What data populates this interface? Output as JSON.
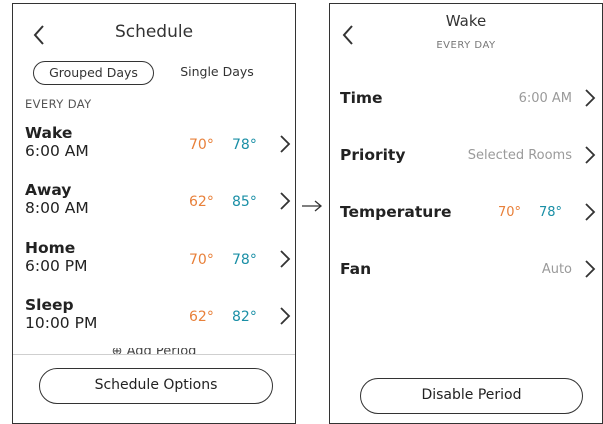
{
  "left": {
    "title": "Schedule",
    "segments": {
      "grouped": "Grouped Days",
      "single": "Single Days"
    },
    "section_label": "EVERY DAY",
    "periods": [
      {
        "name": "Wake",
        "time": "6:00 AM",
        "heat": "70°",
        "cool": "78°"
      },
      {
        "name": "Away",
        "time": "8:00 AM",
        "heat": "62°",
        "cool": "85°"
      },
      {
        "name": "Home",
        "time": "6:00 PM",
        "heat": "70°",
        "cool": "78°"
      },
      {
        "name": "Sleep",
        "time": "10:00 PM",
        "heat": "62°",
        "cool": "82°"
      }
    ],
    "add_period": "⊕ Add Period",
    "options_button": "Schedule Options"
  },
  "right": {
    "title": "Wake",
    "subtitle": "EVERY DAY",
    "rows": {
      "time": {
        "label": "Time",
        "value": "6:00 AM"
      },
      "priority": {
        "label": "Priority",
        "value": "Selected Rooms"
      },
      "temperature": {
        "label": "Temperature",
        "heat": "70°",
        "cool": "78°"
      },
      "fan": {
        "label": "Fan",
        "value": "Auto"
      }
    },
    "disable_button": "Disable Period"
  },
  "arrow": "→",
  "colors": {
    "heat": "#e8803a",
    "cool": "#1a8fa6",
    "outline": "#333333"
  }
}
